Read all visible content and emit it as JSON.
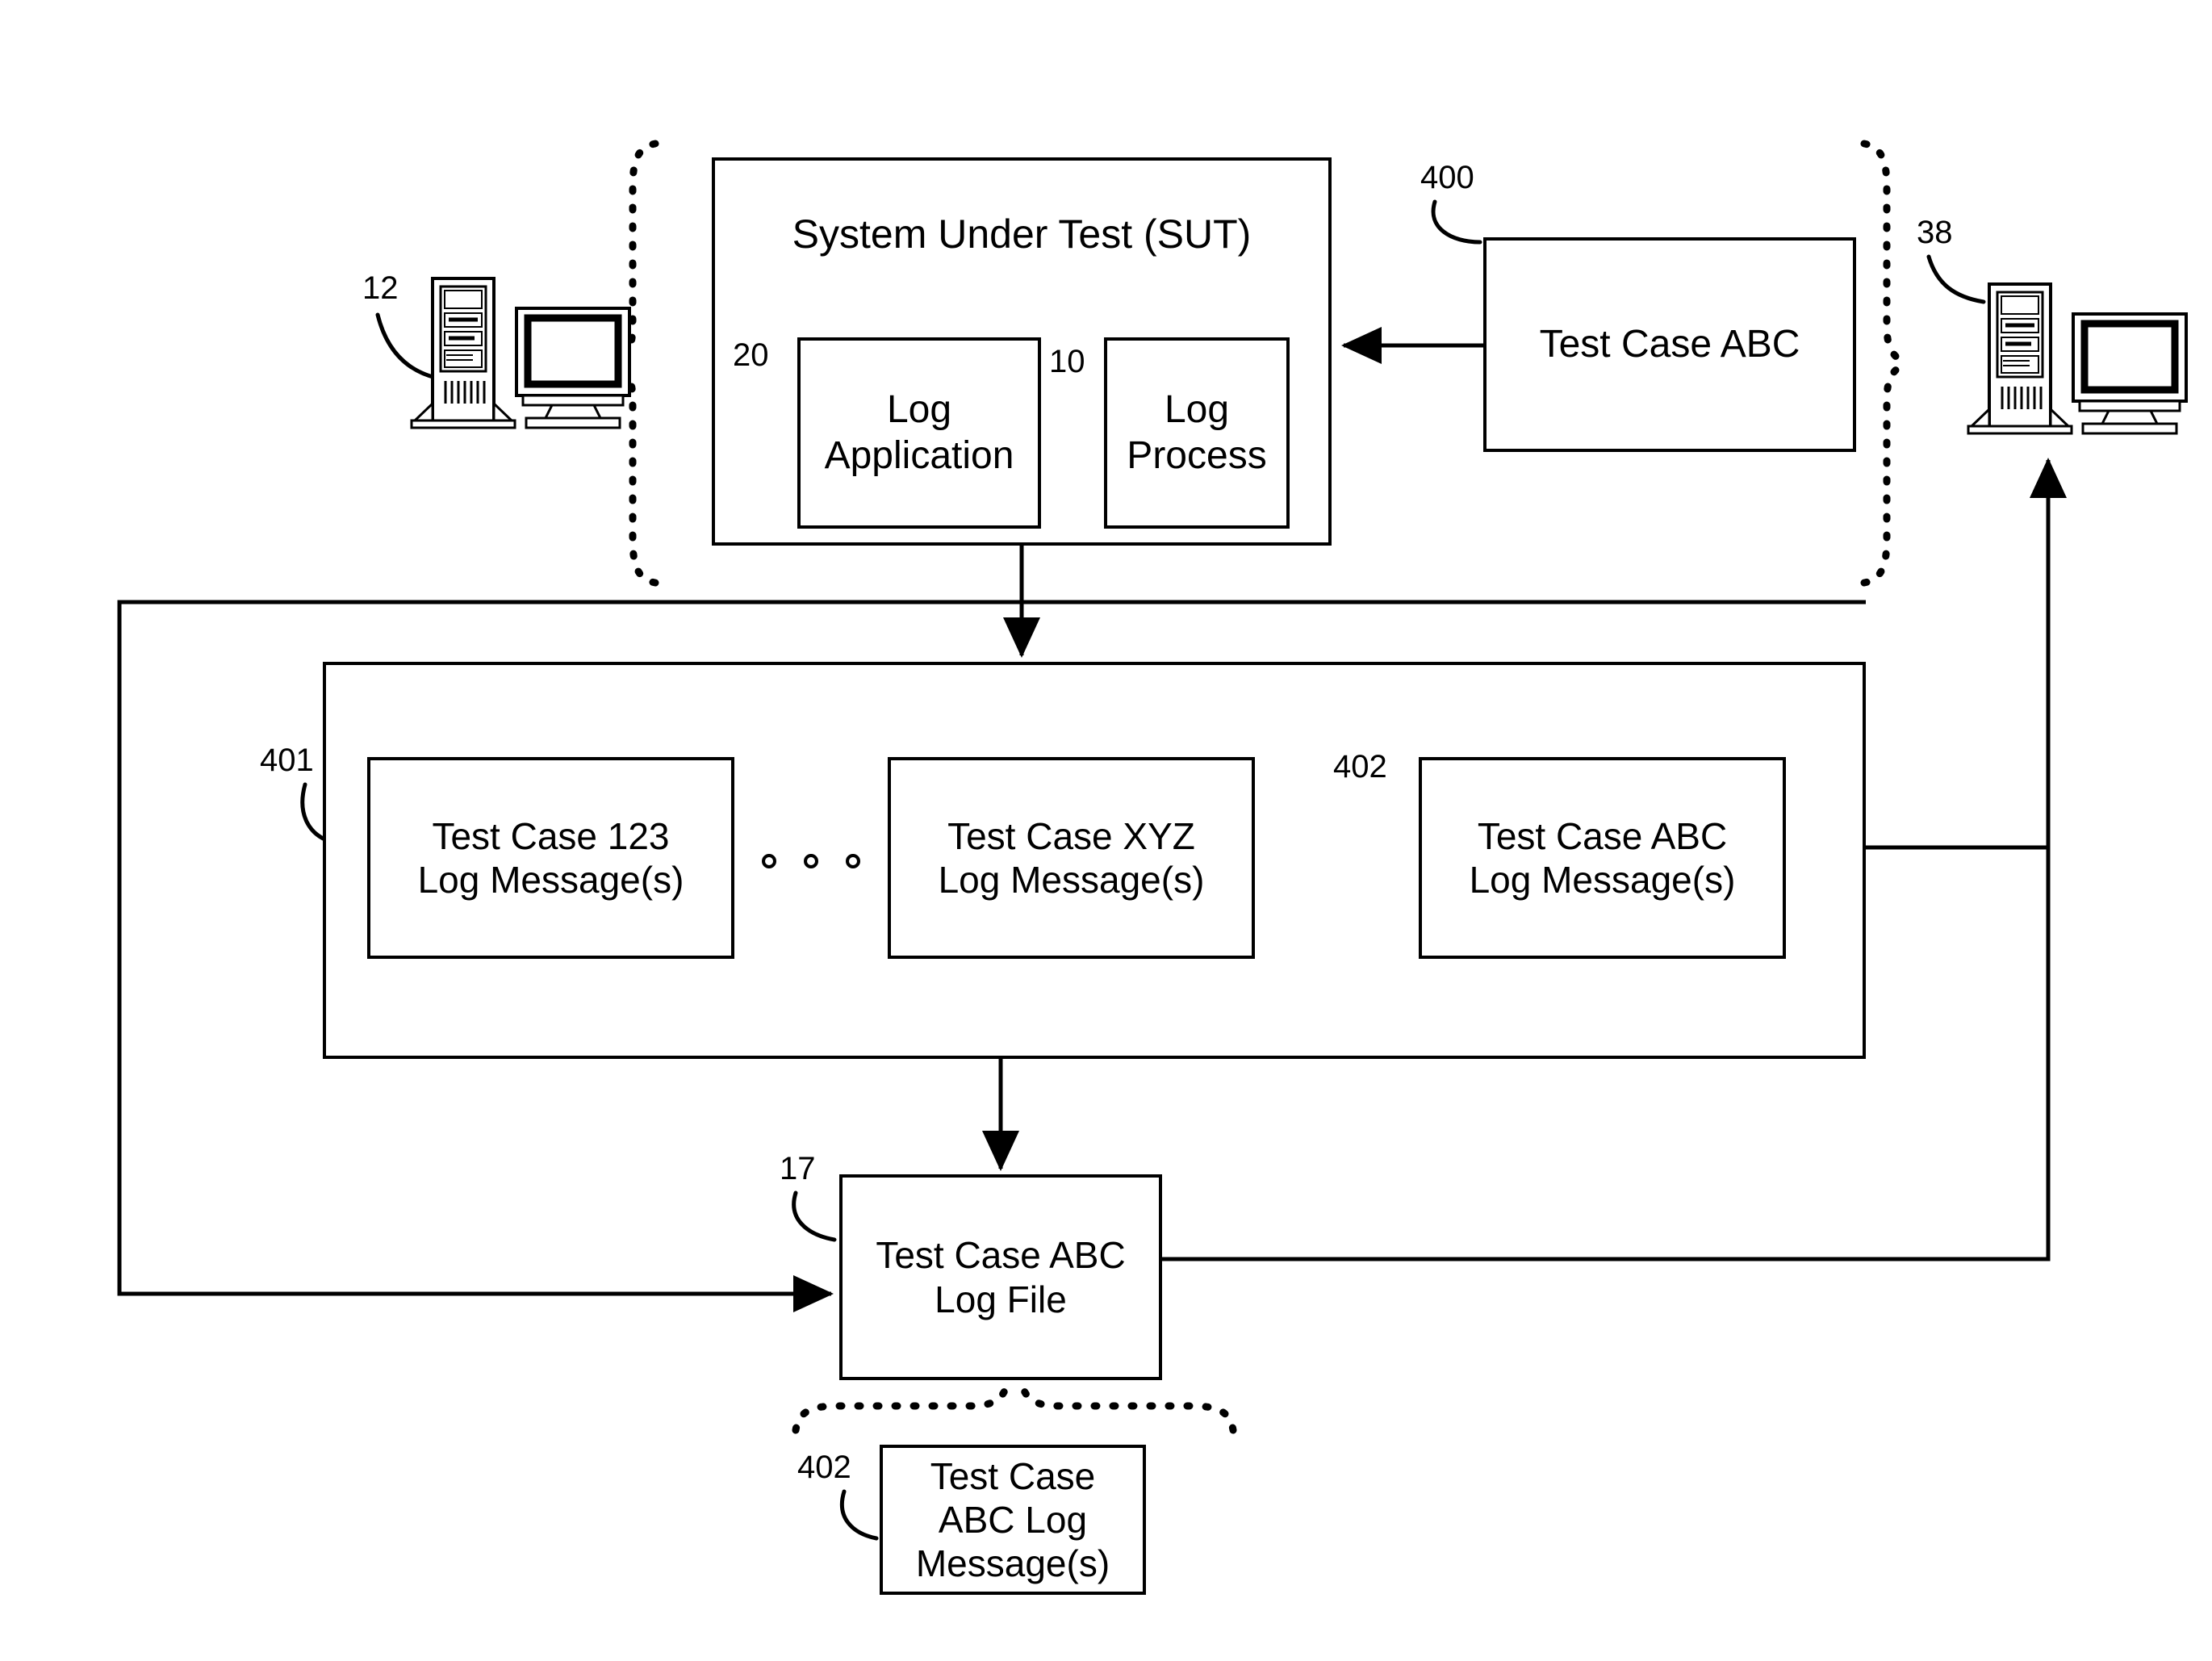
{
  "diagram": {
    "figure_type": "patent-block-diagram",
    "boxes": {
      "sut": {
        "title": "System Under Test (SUT)"
      },
      "log_application": {
        "label": "Log\nApplication"
      },
      "log_process": {
        "label": "Log\nProcess"
      },
      "test_case_abc_input": {
        "label": "Test Case ABC"
      },
      "log_msg_123": {
        "line1": "Test Case 123",
        "line2": "Log Message(s)"
      },
      "log_msg_xyz": {
        "line1": "Test Case XYZ",
        "line2": "Log Message(s)"
      },
      "log_msg_abc": {
        "line1": "Test Case ABC",
        "line2": "Log Message(s)"
      },
      "log_file": {
        "line1": "Test Case ABC",
        "line2": "Log File"
      },
      "log_file_detail": {
        "line1": "Test Case",
        "line2": "ABC Log",
        "line3": "Message(s)"
      }
    },
    "reference_numerals": {
      "sut_computer": "12",
      "log_application": "20",
      "log_process": "10",
      "test_case_abc_input": "400",
      "tester_computer": "38",
      "log_store": "401",
      "log_msg_abc": "402",
      "log_file": "17",
      "log_file_detail": "402"
    },
    "ellipsis": {
      "symbol": "o o o",
      "count": 3
    },
    "colors": {
      "stroke": "#000000",
      "background": "#ffffff"
    },
    "icons": {
      "left_computer": "desktop-computer-icon",
      "right_computer": "desktop-computer-icon"
    }
  }
}
